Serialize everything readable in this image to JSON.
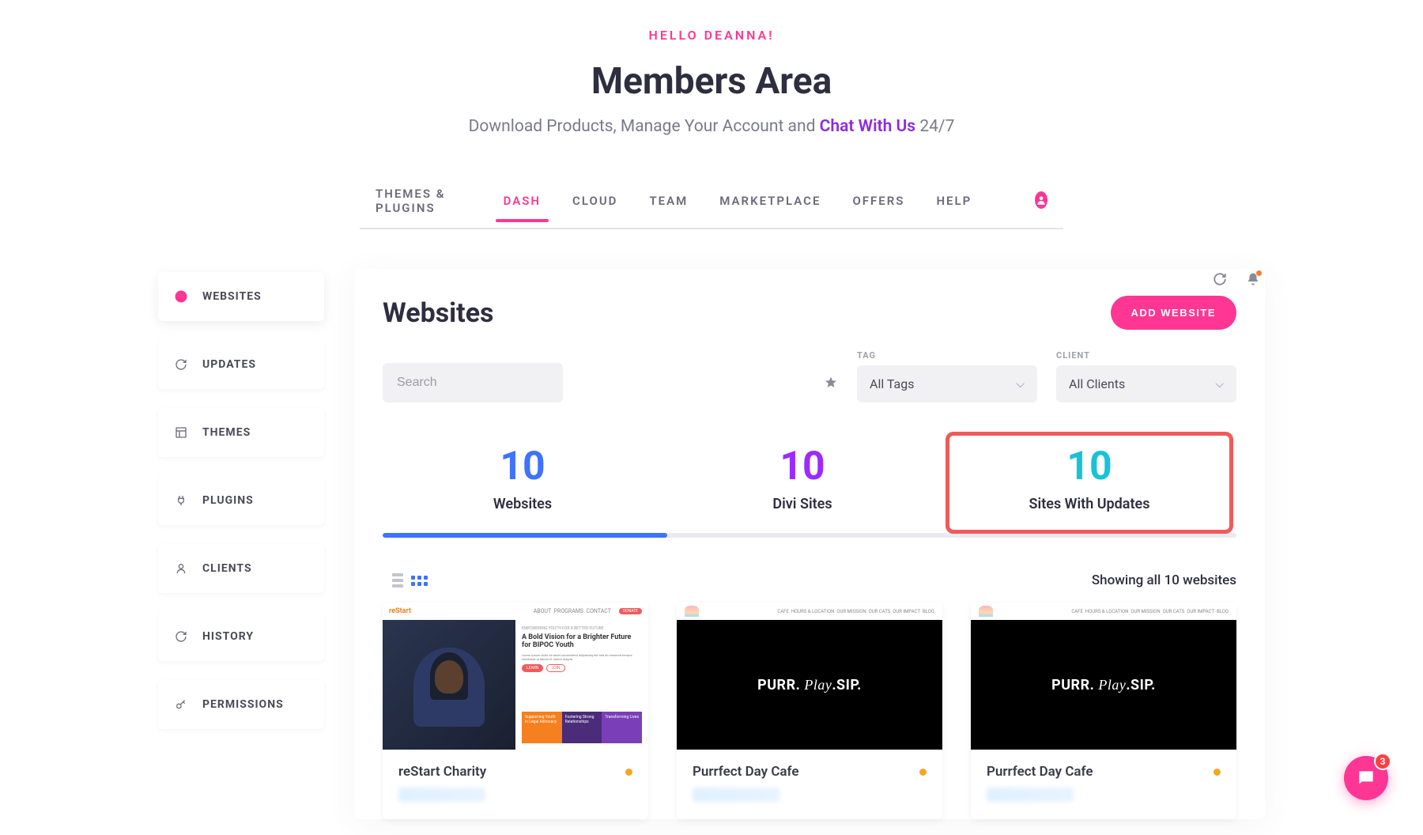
{
  "header": {
    "greeting": "HELLO DEANNA!",
    "title": "Members Area",
    "subtitle_pre": "Download Products, Manage Your Account and ",
    "subtitle_link": "Chat With Us",
    "subtitle_post": " 24/7"
  },
  "topnav": {
    "tabs": [
      {
        "label": "THEMES & PLUGINS"
      },
      {
        "label": "DASH"
      },
      {
        "label": "CLOUD"
      },
      {
        "label": "TEAM"
      },
      {
        "label": "MARKETPLACE"
      },
      {
        "label": "OFFERS"
      },
      {
        "label": "HELP"
      }
    ],
    "active_index": 1
  },
  "sidebar": {
    "items": [
      {
        "icon": "globe-icon",
        "label": "WEBSITES",
        "active": true
      },
      {
        "icon": "refresh-icon",
        "label": "UPDATES"
      },
      {
        "icon": "layout-icon",
        "label": "THEMES"
      },
      {
        "icon": "plug-icon",
        "label": "PLUGINS"
      },
      {
        "icon": "user-icon",
        "label": "CLIENTS"
      },
      {
        "icon": "refresh-icon",
        "label": "HISTORY"
      },
      {
        "icon": "key-icon",
        "label": "PERMISSIONS"
      }
    ]
  },
  "panel": {
    "title": "Websites",
    "add_button": "ADD WEBSITE",
    "search_placeholder": "Search",
    "tag_label": "TAG",
    "tag_selected": "All Tags",
    "client_label": "CLIENT",
    "client_selected": "All Clients"
  },
  "stats": [
    {
      "num": "10",
      "label": "Websites",
      "color": "blue",
      "active": true
    },
    {
      "num": "10",
      "label": "Divi Sites",
      "color": "purple"
    },
    {
      "num": "10",
      "label": "Sites With Updates",
      "color": "teal",
      "highlight": true
    }
  ],
  "results": {
    "count_text": "Showing all 10 websites"
  },
  "cards": [
    {
      "name": "reStart Charity",
      "status_color": "#f5a623",
      "thumb_type": "restart",
      "restart_title": "A Bold Vision for a Brighter Future for BIPOC Youth",
      "logo_text": "reStart"
    },
    {
      "name": "Purrfect Day Cafe",
      "status_color": "#f5a623",
      "thumb_type": "purr",
      "purr_text_a": "PURR.",
      "purr_text_b": "Play",
      "purr_text_c": ".SIP."
    },
    {
      "name": "Purrfect Day Cafe",
      "status_color": "#f5a623",
      "thumb_type": "purr",
      "purr_text_a": "PURR.",
      "purr_text_b": "Play",
      "purr_text_c": ".SIP."
    }
  ],
  "chat": {
    "badge": "3"
  },
  "colors": {
    "pink": "#ff3693",
    "blue": "#3e72ff",
    "purple": "#9d2bff",
    "teal": "#17c3d9",
    "highlight_border": "#f05a5a"
  }
}
